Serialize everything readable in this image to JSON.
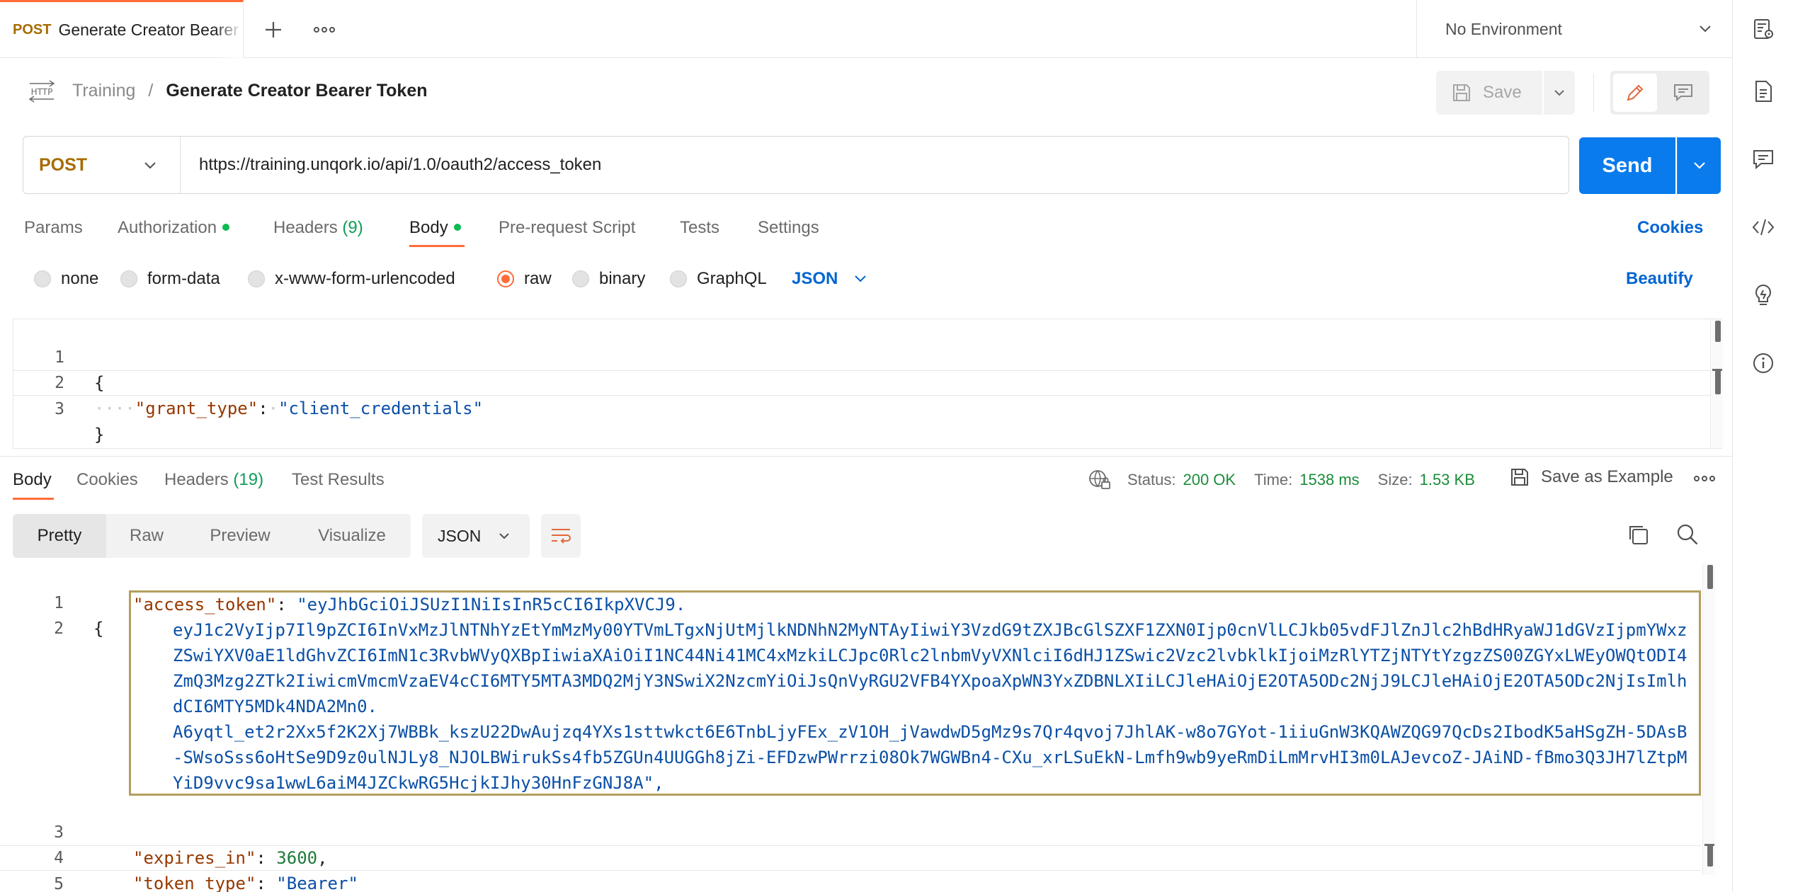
{
  "top_tab": {
    "method": "POST",
    "title": "Generate Creator Bearer Token"
  },
  "environment": {
    "selected": "No Environment"
  },
  "breadcrumb": {
    "parent": "Training",
    "separator": "/",
    "current": "Generate Creator Bearer Token"
  },
  "toolbar": {
    "save_label": "Save"
  },
  "request": {
    "method": "POST",
    "url": "https://training.unqork.io/api/1.0/oauth2/access_token",
    "send_label": "Send"
  },
  "request_tabs": {
    "params": "Params",
    "authorization": "Authorization",
    "headers": "Headers",
    "headers_count": "(9)",
    "body": "Body",
    "pre_request": "Pre-request Script",
    "tests": "Tests",
    "settings": "Settings",
    "cookies": "Cookies"
  },
  "body_types": {
    "none": "none",
    "form_data": "form-data",
    "urlencoded": "x-www-form-urlencoded",
    "raw": "raw",
    "binary": "binary",
    "graphql": "GraphQL",
    "format": "JSON",
    "beautify": "Beautify"
  },
  "request_body": {
    "line_numbers": [
      "1",
      "2",
      "3"
    ],
    "open": "{",
    "indent": "····",
    "key": "\"grant_type\"",
    "colon": ":",
    "value": "\"client_credentials\"",
    "close": "}"
  },
  "response_tabs": {
    "body": "Body",
    "cookies": "Cookies",
    "headers": "Headers",
    "headers_count": "(19)",
    "test_results": "Test Results"
  },
  "response_meta": {
    "status_label": "Status:",
    "status_value": "200 OK",
    "time_label": "Time:",
    "time_value": "1538 ms",
    "size_label": "Size:",
    "size_value": "1.53 KB",
    "save_example": "Save as Example"
  },
  "response_views": {
    "pretty": "Pretty",
    "raw": "Raw",
    "preview": "Preview",
    "visualize": "Visualize",
    "format": "JSON"
  },
  "response_body": {
    "line_numbers": [
      "1",
      "2",
      "3",
      "4",
      "5"
    ],
    "open": "{",
    "access_token_key": "\"access_token\"",
    "access_token_lines": [
      "\"eyJhbGciOiJSUzI1NiIsInR5cCI6IkpXVCJ9.",
      "eyJ1c2VyIjp7Il9pZCI6InVxMzJlNTNhYzEtYmMzMy00YTVmLTgxNjUtMjlkNDNhN2MyNTAyIiwiY3VzdG9tZXJBcGlSZXF1ZXN0Ijp0cnVlLCJkb05vdFJlZnJlc2hBdHRyaWJ1dGVzIjpmYWxzZSwiYXV0aE1ldGhvZCI6ImN1c3RvbWVyQXBpIiwiaXAiOiI1NC44Ni41MC4xMzkiLCJpc0Rlc2lnbmVyVXNlciI6dHJ1ZSwic2Vzc2lvbklkIjoiMzRlYTZjNTYtYzgzZS00ZGYxLWEyOWQtODI4ZmQ3Mzg2ZTk2IiwicmVmcmVzaEV4cCI6MTY5MTA3MDQ2MjY3NSwiX2NzcmYiOiJsQnVyRGU2VFB4YXpoaXpWN3YxZDBNLXIiLCJleHAiOjE2OTA5ODc2NjJ9LCJleHAiOjE2OTA5ODc2NjIsImlhdCI6MTY5MDk4NDA2Mn0.",
      "A6yqtl_et2r2Xx5f2K2Xj7WBBk_kszU22DwAujzq4YXs1sttwkct6E6TnbLjyFEx_zV1OH_jVawdwD5gMz9s7Qr4qvoj7JhlAK-w8o7GYot-1iiuGnW3KQAWZQG97QcDs2IbodK5aHSgZH-5DAsB-SWsoSss6oHtSe9D9z0ulNJLy8_NJOLBWirukSs4fb5ZGUn4UUGGh8jZi-EFDzwPWrrzi08Ok7WGWBn4-CXu_xrLSuEkN-Lmfh9wb9yeRmDiLmMrvHI3m0LAJevcoZ-JAiND-fBmo3Q3JH7lZtpMYiD9vvc9sa1wwL6aiM4JZCkwRG5HcjkIJhy30HnFzGNJ8A\","
    ],
    "expires_in_key": "\"expires_in\"",
    "expires_in_value": "3600",
    "token_type_key": "\"token_type\"",
    "token_type_value": "\"Bearer\"",
    "close": "}"
  },
  "colors": {
    "accent": "#ff6c37",
    "send_blue": "#097bed",
    "link_blue": "#0265d2",
    "status_green": "#1a8d3a",
    "method_post": "#a66b00",
    "highlight_border": "#b39f5f"
  },
  "icons": {
    "new_tab": "plus-icon",
    "more": "ellipsis-icon",
    "env_dropdown": "chevron-down-icon",
    "http": "http-icon",
    "save": "floppy-icon",
    "edit": "pencil-icon",
    "comment": "comment-icon",
    "rail": [
      "environment-icon",
      "documentation-icon",
      "comments-icon",
      "code-icon",
      "lightbulb-icon",
      "info-icon"
    ],
    "globe": "globe-lock-icon",
    "wrap": "wrap-lines-icon",
    "copy": "copy-icon",
    "search": "search-icon"
  }
}
